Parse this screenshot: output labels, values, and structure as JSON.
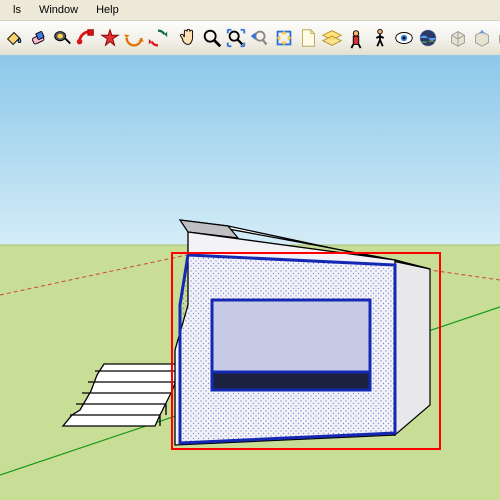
{
  "menu": {
    "items": [
      "ls",
      "Window",
      "Help"
    ]
  },
  "toolbar": {
    "icons": [
      "eraser-icon",
      "tape-measure-icon",
      "dimension-icon",
      "protractor-icon",
      "text-icon",
      "axes-icon",
      "3d-text-icon",
      "section-plane-icon",
      "orbit-icon",
      "pan-icon",
      "zoom-icon",
      "zoom-window-icon",
      "zoom-extents-icon",
      "previous-icon",
      "next-icon",
      "position-camera-icon",
      "look-around-icon",
      "walk-icon",
      "google-earth-icon",
      "get-models-icon",
      "share-model-icon",
      "print-icon"
    ]
  },
  "scene": {
    "sky_color": "#a7d2f0",
    "ground_color": "#c8dd99",
    "selection_box_color": "#ff0000",
    "selected_face_tint": "#3a52d4"
  }
}
